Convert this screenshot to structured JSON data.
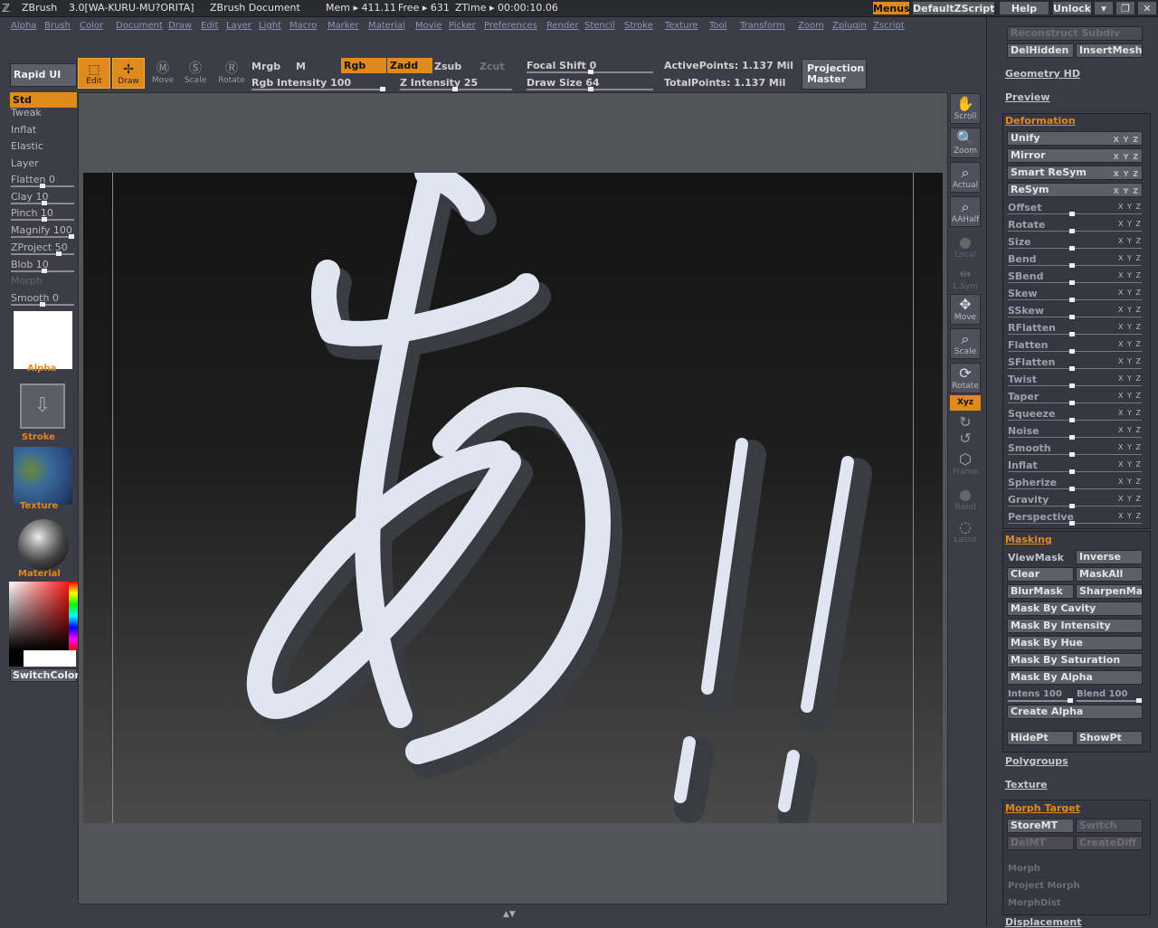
{
  "titlebar": {
    "app": "ZBrush",
    "version": "3.0[WA-KURU-MU?ORITA]",
    "doc": "ZBrush Document",
    "mem": "Mem ▸ 411.11",
    "free": "Free ▸ 631",
    "ztime": "ZTime ▸ 00:00:10.06",
    "menus": "Menus",
    "script": "DefaultZScript",
    "help": "Help",
    "unlock": "Unlock"
  },
  "menu": [
    "Alpha",
    "Brush",
    "Color",
    "Document",
    "Draw",
    "Edit",
    "Layer",
    "Light",
    "Macro",
    "Marker",
    "Material",
    "Movie",
    "Picker",
    "Preferences",
    "Render",
    "Stencil",
    "Stroke",
    "Texture",
    "Tool",
    "Transform",
    "Zoom",
    "Zplugin",
    "Zscript"
  ],
  "toolbar": {
    "rapid": "Rapid UI",
    "edit": "Edit",
    "draw": "Draw",
    "move": "Move",
    "scale": "Scale",
    "rotate": "Rotate",
    "mrgb": "Mrgb",
    "m": "M",
    "rgb": "Rgb",
    "zadd": "Zadd",
    "zsub": "Zsub",
    "zcut": "Zcut",
    "rgb_intensity": "Rgb Intensity 100",
    "z_intensity": "Z Intensity 25",
    "focal_shift": "Focal Shift 0",
    "draw_size": "Draw Size 64",
    "active_points": "ActivePoints: 1.137 Mil",
    "total_points": "TotalPoints: 1.137 Mil",
    "projection_master": "Projection Master"
  },
  "left": {
    "std": "Std",
    "items": [
      "Tweak",
      "Inflat",
      "Elastic",
      "Layer"
    ],
    "sliders": [
      "Flatten 0",
      "Clay 10",
      "Pinch 10",
      "Magnify 100",
      "ZProject 50",
      "Blob 10"
    ],
    "morph": "Morph",
    "smooth": "Smooth 0",
    "alpha": "Alpha",
    "stroke": "Stroke",
    "texture": "Texture",
    "material": "Material",
    "switchcolor": "SwitchColor"
  },
  "righticons": [
    "Scroll",
    "Zoom",
    "Actual",
    "AAHalf",
    "Local",
    "L.Sym",
    "Move",
    "Scale",
    "Rotate",
    "Xyz",
    "Frame",
    "Rand",
    "Lasso"
  ],
  "rpanel": {
    "reconstruct": "Reconstruct Subdiv",
    "delhidden": "DelHidden",
    "insertmesh": "InsertMesh",
    "geometry_hd": "Geometry HD",
    "preview": "Preview",
    "deformation": "Deformation",
    "deform_buttons": [
      "Unify",
      "Mirror",
      "Smart ReSym",
      "ReSym"
    ],
    "deform_sliders": [
      "Offset",
      "Rotate",
      "Size",
      "Bend",
      "SBend",
      "Skew",
      "SSkew",
      "RFlatten",
      "Flatten",
      "SFlatten",
      "Twist",
      "Taper",
      "Squeeze",
      "Noise",
      "Smooth",
      "Inflat",
      "Spherize",
      "Gravity",
      "Perspective"
    ],
    "xyz": "X Y Z",
    "masking": "Masking",
    "viewmask": "ViewMask",
    "inverse": "Inverse",
    "clear": "Clear",
    "maskall": "MaskAll",
    "blurmask": "BlurMask",
    "sharpenmask": "SharpenMask",
    "mask_full": [
      "Mask By Cavity",
      "Mask By Intensity",
      "Mask By Hue",
      "Mask By Saturation",
      "Mask By Alpha"
    ],
    "intens": "Intens 100",
    "blend": "Blend 100",
    "create_alpha": "Create Alpha",
    "hidept": "HidePt",
    "showpt": "ShowPt",
    "polygroups": "Polygroups",
    "texture": "Texture",
    "morph_target": "Morph Target",
    "storemt": "StoreMT",
    "switch": "Switch",
    "delmt": "DelMT",
    "creatediff": "CreateDiff",
    "morph": "Morph",
    "project_morph": "Project Morph",
    "morphdist": "MorphDist",
    "displacement": "Displacement"
  }
}
